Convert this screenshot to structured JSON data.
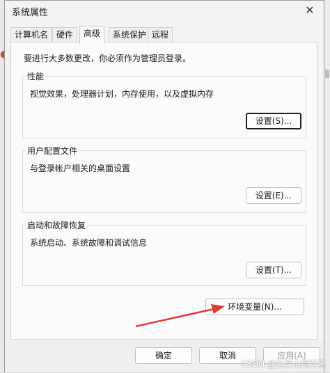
{
  "window": {
    "title": "系统属性",
    "close_glyph": "✕"
  },
  "tabs": [
    {
      "label": "计算机名"
    },
    {
      "label": "硬件"
    },
    {
      "label": "高级",
      "active": true
    },
    {
      "label": "系统保护"
    },
    {
      "label": "远程"
    }
  ],
  "notice": "要进行大多数更改，你必须作为管理员登录。",
  "groups": [
    {
      "title": "性能",
      "description": "视觉效果，处理器计划，内存使用，以及虚拟内存",
      "button": "设置(S)..."
    },
    {
      "title": "用户配置文件",
      "description": "与登录帐户相关的桌面设置",
      "button": "设置(E)..."
    },
    {
      "title": "启动和故障恢复",
      "description": "系统启动、系统故障和调试信息",
      "button": "设置(T)..."
    }
  ],
  "env_button": "环境变量(N)...",
  "footer": {
    "ok": "确定",
    "cancel": "取消",
    "apply": "应用(A)"
  },
  "annotation": {
    "arrow_color": "#e53935"
  },
  "watermark": "CSDN @纵享山河万里"
}
